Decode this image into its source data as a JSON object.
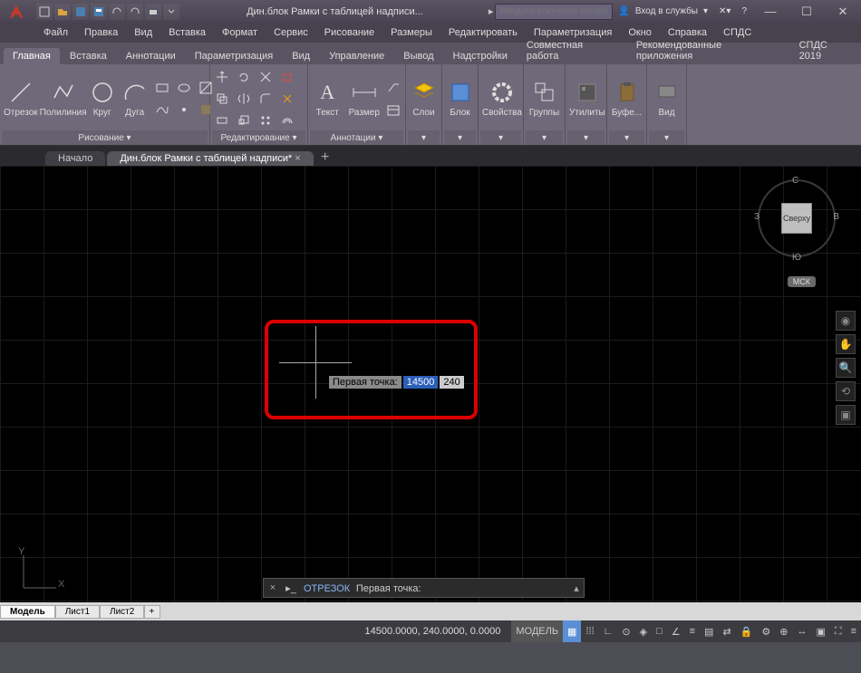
{
  "title": "Дин.блок Рамки с таблицей надписи...",
  "search_placeholder": "Введите ключевое слово/фразу",
  "account": "Вход в службы",
  "menus": [
    "Файл",
    "Правка",
    "Вид",
    "Вставка",
    "Формат",
    "Сервис",
    "Рисование",
    "Размеры",
    "Редактировать",
    "Параметризация",
    "Окно",
    "Справка",
    "СПДС"
  ],
  "ribtabs": [
    "Главная",
    "Вставка",
    "Аннотации",
    "Параметризация",
    "Вид",
    "Управление",
    "Вывод",
    "Надстройки",
    "Совместная работа",
    "Рекомендованные приложения",
    "СПДС 2019"
  ],
  "panels": {
    "draw": "Рисование ▾",
    "edit": "Редактирование ▾",
    "anno": "Аннотации ▾",
    "layers": "Слои",
    "block": "Блок",
    "props": "Свойства",
    "groups": "Группы",
    "utils": "Утилиты",
    "clip": "Буфе...",
    "view": "Вид"
  },
  "draw": {
    "line": "Отрезок",
    "pline": "Полилиния",
    "circle": "Круг",
    "arc": "Дуга"
  },
  "anno_btns": {
    "text": "Текст",
    "dim": "Размер"
  },
  "doctabs": {
    "start": "Начало",
    "doc": "Дин.блок Рамки с таблицей надписи*"
  },
  "dyn": {
    "label": "Первая точка:",
    "x": "14500",
    "y": "240"
  },
  "ucs": {
    "x": "X",
    "y": "Y"
  },
  "viewcube": {
    "face": "Сверху",
    "n": "С",
    "s": "Ю",
    "e": "В",
    "w": "З",
    "wcs": "МСК"
  },
  "cmd": {
    "name": "ОТРЕЗОК",
    "prompt": "Первая точка:"
  },
  "status": {
    "coords": "14500.0000, 240.0000, 0.0000",
    "model": "МОДЕЛЬ"
  },
  "modeltabs": [
    "Модель",
    "Лист1",
    "Лист2"
  ],
  "icons": {
    "person": "👤",
    "help": "?",
    "dash": "—",
    "sq": "☐",
    "x": "✕",
    "plus": "+",
    "grid": "▦",
    "snap": "⊞"
  }
}
